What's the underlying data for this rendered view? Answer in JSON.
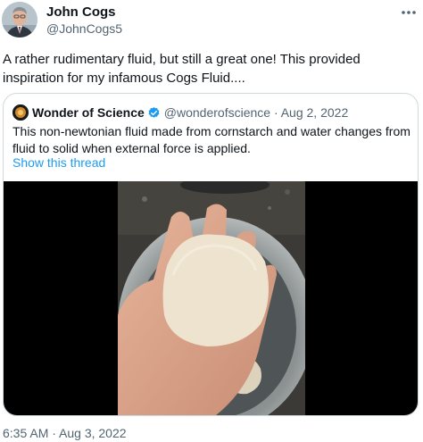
{
  "author": {
    "name": "John Cogs",
    "handle": "@JohnCogs5"
  },
  "tweet": {
    "text": "A rather rudimentary fluid, but still a great one! This provided inspiration for my infamous Cogs Fluid....",
    "timestamp": "6:35 AM · Aug 3, 2022"
  },
  "quoted": {
    "name": "Wonder of Science",
    "handle_date": "@wonderofscience · Aug 2, 2022",
    "text": "This non-newtonian fluid made from cornstarch and water changes from fluid to solid when external force is applied.",
    "show_thread": "Show this thread",
    "verified": true
  },
  "icons": {
    "more": "more-horizontal-icon",
    "verified": "verified-badge-icon"
  },
  "colors": {
    "link": "#1d9bf0",
    "secondary_text": "#536471",
    "border": "#cfd9de",
    "verified": "#1d9bf0"
  }
}
